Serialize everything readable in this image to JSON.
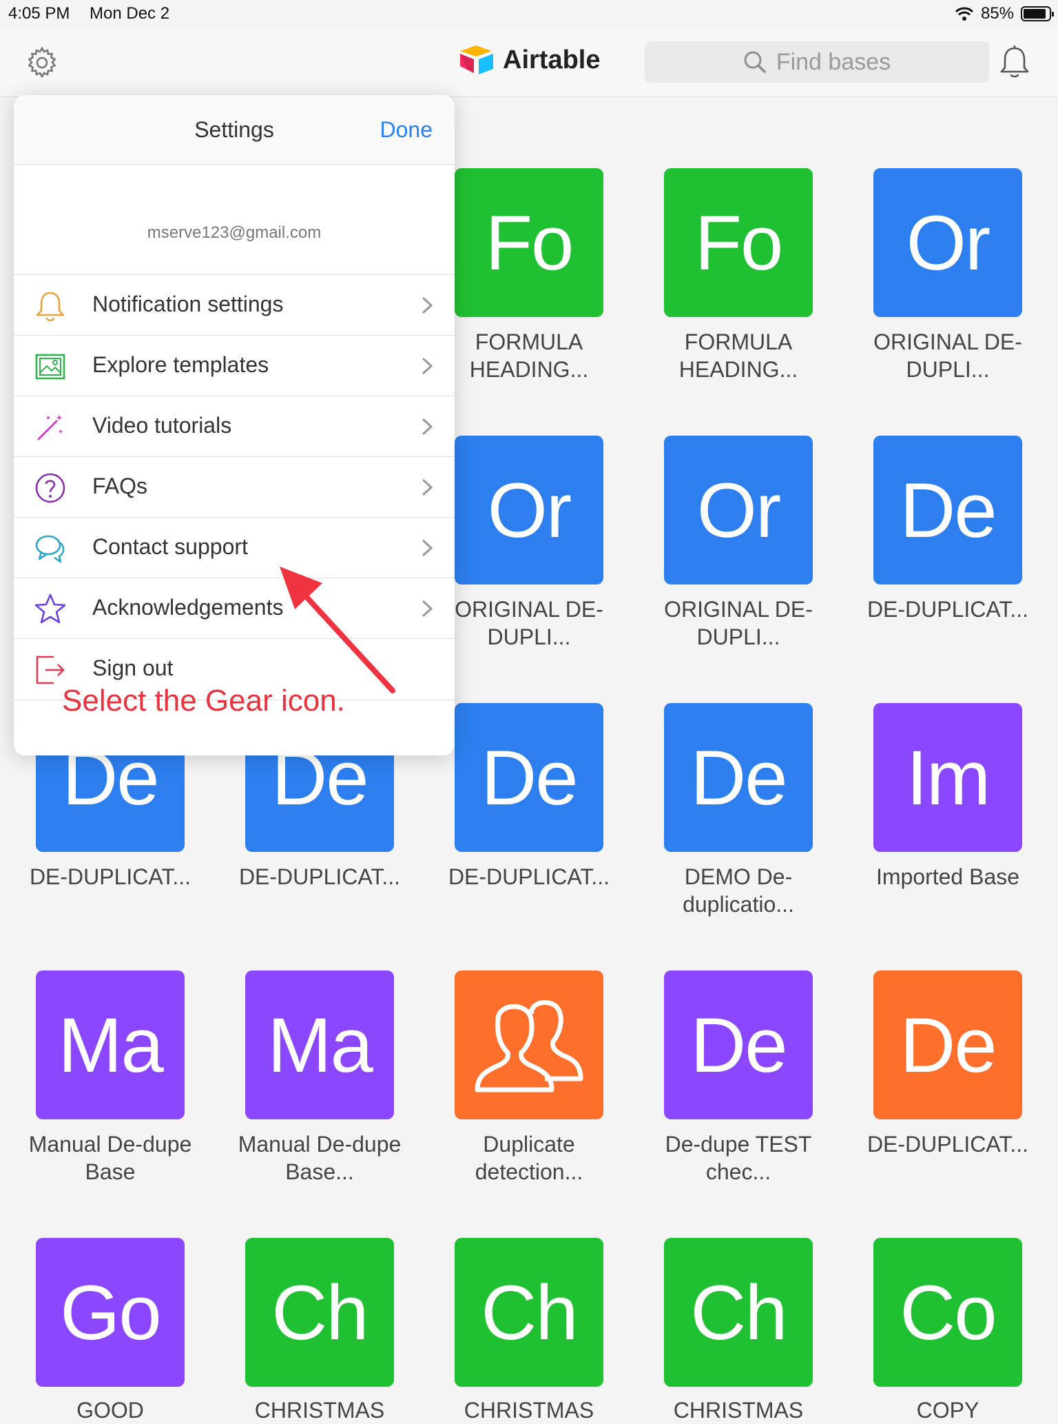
{
  "statusbar": {
    "time": "4:05 PM",
    "date": "Mon Dec 2",
    "battery": "85%"
  },
  "navbar": {
    "brand": "Airtable",
    "search_placeholder": "Find bases"
  },
  "popover": {
    "title": "Settings",
    "done": "Done",
    "email": "mserve123@gmail.com",
    "items": [
      {
        "label": "Notification settings",
        "icon": "bell-icon"
      },
      {
        "label": "Explore templates",
        "icon": "image-icon"
      },
      {
        "label": "Video tutorials",
        "icon": "magic-wand-icon"
      },
      {
        "label": "FAQs",
        "icon": "question-icon"
      },
      {
        "label": "Contact support",
        "icon": "chat-bubbles-icon"
      },
      {
        "label": "Acknowledgements",
        "icon": "star-icon"
      },
      {
        "label": "Sign out",
        "icon": "sign-out-icon"
      }
    ]
  },
  "annotation": "Select the Gear icon.",
  "bases": [
    {
      "abbr": "Fo",
      "name": "FORMULA HEADING...",
      "color": "#20c033"
    },
    {
      "abbr": "Fo",
      "name": "FORMULA HEADING...",
      "color": "#20c033"
    },
    {
      "abbr": "Or",
      "name": "ORIGINAL DE-DUPLI...",
      "color": "#2d7ff0"
    },
    {
      "abbr": "Or",
      "name": "ORIGINAL DE-DUPLI...",
      "color": "#2d7ff0"
    },
    {
      "abbr": "Or",
      "name": "ORIGINAL DE-DUPLI...",
      "color": "#2d7ff0"
    },
    {
      "abbr": "De",
      "name": "DE-DUPLICAT...",
      "color": "#2d7ff0"
    },
    {
      "abbr": "De",
      "name": "DE-DUPLICAT...",
      "color": "#2d7ff0"
    },
    {
      "abbr": "De",
      "name": "DE-DUPLICAT...",
      "color": "#2d7ff0"
    },
    {
      "abbr": "De",
      "name": "DE-DUPLICAT...",
      "color": "#2d7ff0"
    },
    {
      "abbr": "De",
      "name": "DEMO De-duplicatio...",
      "color": "#2d7ff0"
    },
    {
      "abbr": "Im",
      "name": "Imported Base",
      "color": "#8b46ff"
    },
    {
      "abbr": "Ma",
      "name": "Manual De-dupe Base",
      "color": "#8b46ff"
    },
    {
      "abbr": "Ma",
      "name": "Manual De-dupe Base...",
      "color": "#8b46ff"
    },
    {
      "abbr": "",
      "name": "Duplicate detection...",
      "color": "#ff6f2c",
      "icon": "users-icon"
    },
    {
      "abbr": "De",
      "name": "De-dupe TEST chec...",
      "color": "#8b46ff"
    },
    {
      "abbr": "De",
      "name": "DE-DUPLICAT...",
      "color": "#ff6f2c"
    },
    {
      "abbr": "Go",
      "name": "GOOD",
      "color": "#8b46ff"
    },
    {
      "abbr": "Ch",
      "name": "CHRISTMAS",
      "color": "#20c033"
    },
    {
      "abbr": "Ch",
      "name": "CHRISTMAS",
      "color": "#20c033"
    },
    {
      "abbr": "Ch",
      "name": "CHRISTMAS",
      "color": "#20c033"
    },
    {
      "abbr": "Co",
      "name": "COPY",
      "color": "#20c033"
    }
  ]
}
